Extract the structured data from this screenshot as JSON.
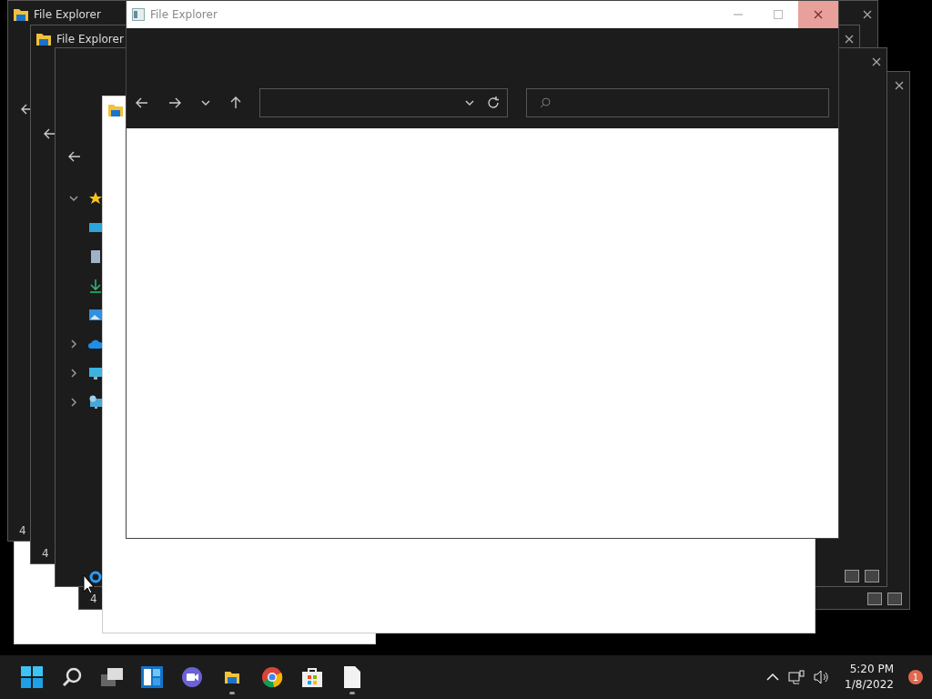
{
  "windows": [
    {
      "kind": "blank"
    },
    {
      "kind": "dark",
      "title": "File Explorer",
      "status": "4"
    },
    {
      "kind": "dark",
      "title": "File Explorer",
      "status": "4"
    },
    {
      "kind": "dark",
      "status": "4"
    },
    {
      "kind": "dark",
      "nav": [
        {
          "kind": "star",
          "expanded": true,
          "children": [
            {
              "kind": "desktop"
            },
            {
              "kind": "documents"
            },
            {
              "kind": "downloads"
            },
            {
              "kind": "pictures"
            }
          ]
        },
        {
          "kind": "cloud",
          "expanded": false
        },
        {
          "kind": "pc",
          "expanded": false
        },
        {
          "kind": "network",
          "expanded": false
        }
      ]
    },
    {
      "kind": "blank",
      "icon": true
    },
    {
      "kind": "front",
      "title": "File Explorer"
    }
  ],
  "taskbar": {
    "apps": [
      {
        "kind": "start",
        "running": false
      },
      {
        "kind": "search",
        "running": false
      },
      {
        "kind": "taskview",
        "running": false
      },
      {
        "kind": "widgets",
        "running": false
      },
      {
        "kind": "chat",
        "running": false
      },
      {
        "kind": "explorer",
        "running": true
      },
      {
        "kind": "browser",
        "running": false
      },
      {
        "kind": "store",
        "running": false
      },
      {
        "kind": "notepad",
        "running": true
      }
    ],
    "time": "5:20 PM",
    "date": "1/8/2022",
    "badge": "1"
  }
}
